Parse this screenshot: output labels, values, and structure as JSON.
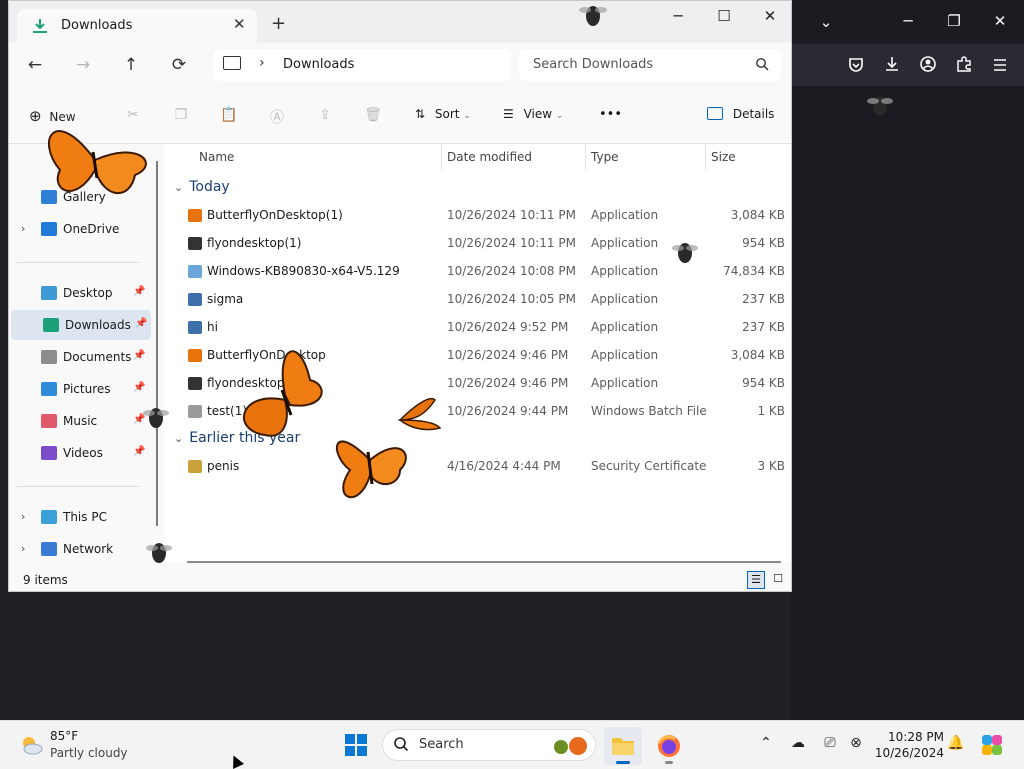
{
  "explorer": {
    "tab_title": "Downloads",
    "tab_close": "✕",
    "new_tab": "+",
    "window_controls": {
      "minimize": "─",
      "maximize": "☐",
      "close": "✕"
    },
    "nav": {
      "back": "←",
      "forward": "→",
      "up": "↑",
      "refresh": "⟳"
    },
    "breadcrumb": {
      "chevron": "›",
      "location": "Downloads"
    },
    "search_placeholder": "Search Downloads",
    "command_bar": {
      "new_label": "New",
      "sort_label": "Sort",
      "view_label": "View",
      "more_label": "•••",
      "details_label": "Details"
    },
    "sidebar": {
      "items": [
        {
          "label": "Gallery",
          "expander": "",
          "pin": "",
          "icon": "gallery-icon",
          "color": "#2f7fd6"
        },
        {
          "label": "OneDrive",
          "expander": "›",
          "pin": "",
          "icon": "cloud-icon",
          "color": "#1f7ad8"
        },
        {
          "label": "Desktop",
          "expander": "",
          "pin": "📌",
          "icon": "desktop-icon",
          "color": "#3d9ad6"
        },
        {
          "label": "Downloads",
          "expander": "",
          "pin": "📌",
          "icon": "download-icon",
          "color": "#1aa179"
        },
        {
          "label": "Documents",
          "expander": "",
          "pin": "📌",
          "icon": "documents-icon",
          "color": "#8c8c8c"
        },
        {
          "label": "Pictures",
          "expander": "",
          "pin": "📌",
          "icon": "pictures-icon",
          "color": "#2e8bd9"
        },
        {
          "label": "Music",
          "expander": "",
          "pin": "📌",
          "icon": "music-icon",
          "color": "#e05a6a"
        },
        {
          "label": "Videos",
          "expander": "",
          "pin": "📌",
          "icon": "videos-icon",
          "color": "#7b4cc9"
        },
        {
          "label": "This PC",
          "expander": "›",
          "pin": "",
          "icon": "pc-icon",
          "color": "#3aa0d8"
        },
        {
          "label": "Network",
          "expander": "›",
          "pin": "",
          "icon": "network-icon",
          "color": "#3a7bd5"
        }
      ]
    },
    "columns": {
      "name": "Name",
      "date": "Date modified",
      "type": "Type",
      "size": "Size"
    },
    "groups": [
      {
        "label": "Today",
        "chevron": "⌄",
        "files": [
          {
            "name": "ButterflyOnDesktop(1)",
            "date": "10/26/2024 10:11 PM",
            "type": "Application",
            "size": "3,084 KB",
            "icon": "butterfly-icon"
          },
          {
            "name": "flyondesktop(1)",
            "date": "10/26/2024 10:11 PM",
            "type": "Application",
            "size": "954 KB",
            "icon": "fly-icon"
          },
          {
            "name": "Windows-KB890830-x64-V5.129",
            "date": "10/26/2024 10:08 PM",
            "type": "Application",
            "size": "74,834 KB",
            "icon": "installer-icon"
          },
          {
            "name": "sigma",
            "date": "10/26/2024 10:05 PM",
            "type": "Application",
            "size": "237 KB",
            "icon": "app-icon"
          },
          {
            "name": "hi",
            "date": "10/26/2024 9:52 PM",
            "type": "Application",
            "size": "237 KB",
            "icon": "app-icon"
          },
          {
            "name": "ButterflyOnDesktop",
            "date": "10/26/2024 9:46 PM",
            "type": "Application",
            "size": "3,084 KB",
            "icon": "butterfly-icon"
          },
          {
            "name": "flyondesktop",
            "date": "10/26/2024 9:46 PM",
            "type": "Application",
            "size": "954 KB",
            "icon": "fly-icon"
          },
          {
            "name": "test(1)",
            "date": "10/26/2024 9:44 PM",
            "type": "Windows Batch File",
            "size": "1 KB",
            "icon": "batch-file-icon"
          }
        ]
      },
      {
        "label": "Earlier this year",
        "chevron": "⌄",
        "files": [
          {
            "name": "penis",
            "date": "4/16/2024 4:44 PM",
            "type": "Security Certificate",
            "size": "3 KB",
            "icon": "certificate-icon"
          }
        ]
      }
    ],
    "status_count": "9 items"
  },
  "browser": {
    "tab_list": "⌄",
    "window_controls": {
      "minimize": "─",
      "restore": "❐",
      "close": "✕"
    },
    "toolbar_icons": [
      "pocket-icon",
      "downloads-icon",
      "account-icon",
      "extensions-icon",
      "menu-icon"
    ]
  },
  "taskbar": {
    "weather_temp": "85°F",
    "weather_condition": "Partly cloudy",
    "search_label": "Search",
    "clock_time": "10:28 PM",
    "clock_date": "10/26/2024",
    "accent": "#0067c0"
  }
}
